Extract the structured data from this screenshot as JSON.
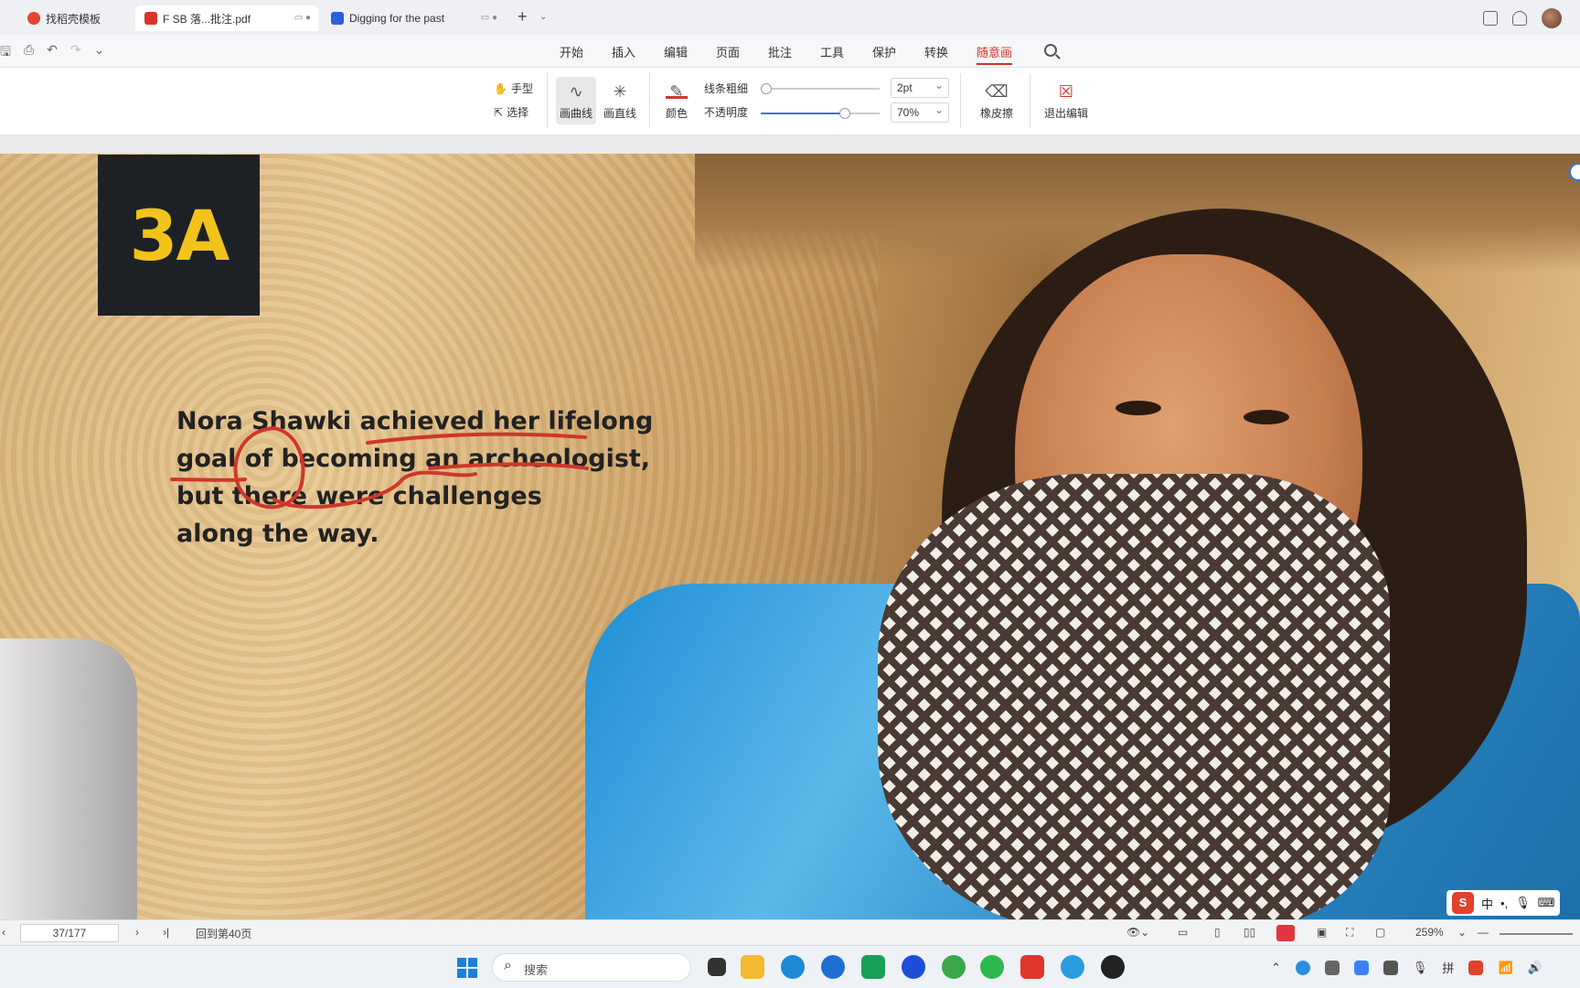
{
  "tabs": [
    {
      "label": "找稻壳模板",
      "active": false
    },
    {
      "label": "F SB 落...批注.pdf",
      "active": true
    },
    {
      "label": "Digging for the past",
      "active": false
    }
  ],
  "menu": {
    "items": [
      "开始",
      "插入",
      "编辑",
      "页面",
      "批注",
      "工具",
      "保护",
      "转换"
    ],
    "active": "随意画"
  },
  "ink_toolbar": {
    "hand": "手型",
    "select": "选择",
    "curve": "画曲线",
    "line": "画直线",
    "color": "颜色",
    "line_width_label": "线条粗细",
    "opacity_label": "不透明度",
    "line_width_value": "2pt",
    "opacity_value": "70%",
    "eraser": "橡皮擦",
    "exit": "退出编辑",
    "pen_color": "#d0362b"
  },
  "document": {
    "badge": "3A",
    "caption_lines": [
      "Nora Shawki achieved her lifelong",
      "goal of becoming an archeologist,",
      "but there were challenges",
      "along the way."
    ]
  },
  "statusbar": {
    "page": "37/177",
    "goto": "回到第40页",
    "zoom": "259%"
  },
  "ime": {
    "mode": "中"
  },
  "taskbar": {
    "search_placeholder": "搜索"
  }
}
